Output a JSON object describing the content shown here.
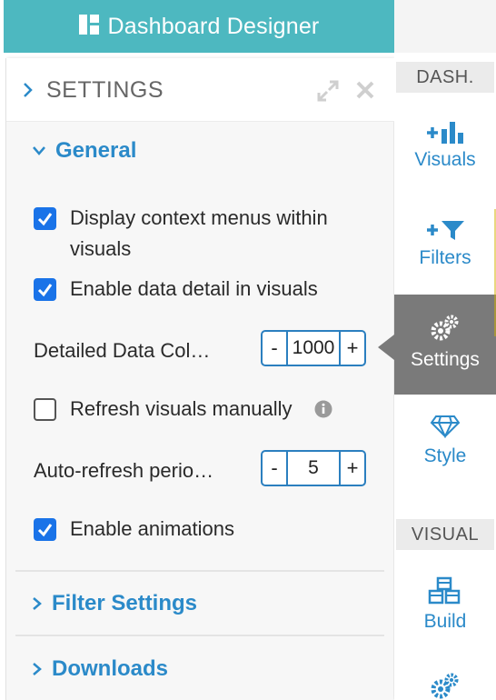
{
  "header": {
    "title": "Dashboard Designer",
    "icon": "dashboard-icon"
  },
  "panel": {
    "title": "SETTINGS",
    "sections": {
      "general": {
        "title": "General",
        "display_context_menus": {
          "line1": "Display context menus within",
          "line2": "visuals",
          "checked": true
        },
        "enable_data_detail": {
          "label": "Enable data detail in visuals",
          "checked": true
        },
        "detailed_data": {
          "label": "Detailed Data Col…",
          "minus": "-",
          "value": "1000",
          "plus": "+"
        },
        "refresh_manually": {
          "label": "Refresh visuals manually",
          "checked": false
        },
        "auto_refresh": {
          "label": "Auto-refresh perio…",
          "minus": "-",
          "value": "5",
          "plus": "+"
        },
        "enable_animations": {
          "label": "Enable animations",
          "checked": true
        }
      },
      "filter_settings": {
        "title": "Filter Settings"
      },
      "downloads": {
        "title": "Downloads"
      }
    }
  },
  "rail": {
    "dash_header": "DASH.",
    "visual_header": "VISUAL",
    "items": [
      {
        "label": "Visuals",
        "icon": "add-chart-icon"
      },
      {
        "label": "Filters",
        "icon": "add-filter-icon"
      },
      {
        "label": "Settings",
        "icon": "gears-icon",
        "active": true
      },
      {
        "label": "Style",
        "icon": "diamond-icon"
      },
      {
        "label": "Build",
        "icon": "cubes-icon"
      }
    ]
  },
  "colors": {
    "header_bg": "#4db8c0",
    "accent": "#2b8ac9",
    "checkbox": "#1a73e8",
    "active_rail": "#7a7a7a"
  }
}
